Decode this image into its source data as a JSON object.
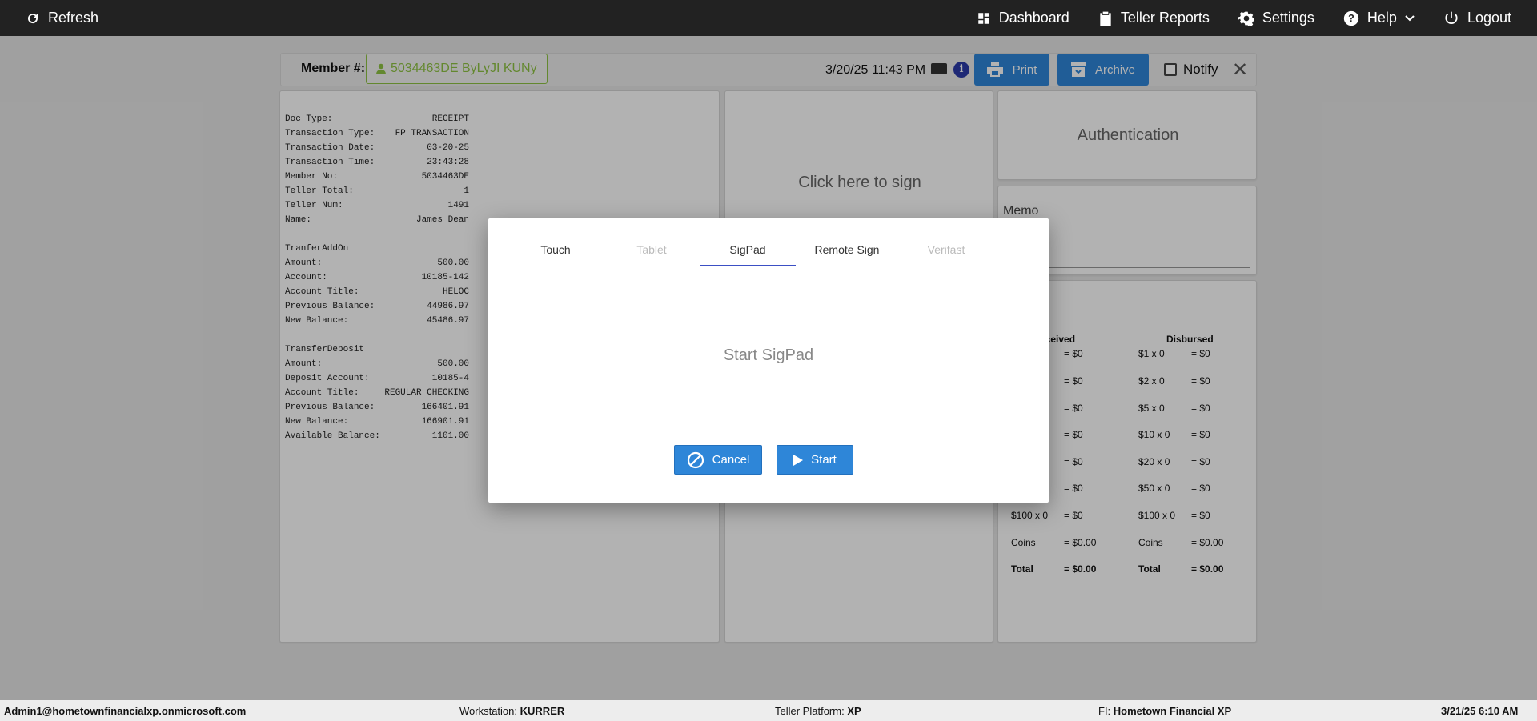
{
  "nav": {
    "refresh": "Refresh",
    "items": [
      {
        "label": "Dashboard",
        "icon": "dashboard-icon"
      },
      {
        "label": "Teller Reports",
        "icon": "clipboard-icon"
      },
      {
        "label": "Settings",
        "icon": "gear-icon"
      },
      {
        "label": "Help",
        "icon": "help-icon"
      },
      {
        "label": "Logout",
        "icon": "power-icon"
      }
    ]
  },
  "member": {
    "label": "Member #:",
    "value": "5034463DE ByLyJI KUNy",
    "datetime": "3/20/25 11:43 PM",
    "print": "Print",
    "archive": "Archive",
    "notify": "Notify"
  },
  "receipt": [
    [
      "Doc Type:",
      "RECEIPT"
    ],
    [
      "Transaction Type:",
      "FP TRANSACTION"
    ],
    [
      "Transaction Date:",
      "03-20-25"
    ],
    [
      "Transaction Time:",
      "23:43:28"
    ],
    [
      "Member No:",
      "5034463DE"
    ],
    [
      "Teller Total:",
      "1"
    ],
    [
      "Teller Num:",
      "1491"
    ],
    [
      "Name:",
      "James Dean"
    ],
    [
      "",
      ""
    ],
    [
      "TranferAddOn",
      ""
    ],
    [
      "Amount:",
      "500.00"
    ],
    [
      "Account:",
      "10185-142"
    ],
    [
      "Account Title:",
      "HELOC"
    ],
    [
      "Previous Balance:",
      "44986.97"
    ],
    [
      "New Balance:",
      "45486.97"
    ],
    [
      "",
      ""
    ],
    [
      "TransferDeposit",
      ""
    ],
    [
      "Amount:",
      "500.00"
    ],
    [
      "Deposit Account:",
      "10185-4"
    ],
    [
      "Account Title:",
      "REGULAR CHECKING"
    ],
    [
      "Previous Balance:",
      "166401.91"
    ],
    [
      "New Balance:",
      "166901.91"
    ],
    [
      "Available Balance:",
      "1101.00"
    ]
  ],
  "sign": {
    "click": "Click here to sign"
  },
  "auth": {
    "title": "Authentication"
  },
  "memo": {
    "label": "Memo"
  },
  "cash": {
    "received_head": "eceived",
    "disbursed_head": "Disbursed",
    "received": [
      [
        "",
        "= $0"
      ],
      [
        "",
        "= $0"
      ],
      [
        "",
        "= $0"
      ],
      [
        "",
        "= $0"
      ],
      [
        "",
        "= $0"
      ],
      [
        "",
        "= $0"
      ],
      [
        "$100 x 0",
        "= $0"
      ],
      [
        "Coins",
        "= $0.00"
      ],
      [
        "Total",
        "= $0.00"
      ]
    ],
    "disbursed": [
      [
        "$1 x 0",
        "= $0"
      ],
      [
        "$2 x 0",
        "= $0"
      ],
      [
        "$5 x 0",
        "= $0"
      ],
      [
        "$10 x 0",
        "= $0"
      ],
      [
        "$20 x 0",
        "= $0"
      ],
      [
        "$50 x 0",
        "= $0"
      ],
      [
        "$100 x 0",
        "= $0"
      ],
      [
        "Coins",
        "= $0.00"
      ],
      [
        "Total",
        "= $0.00"
      ]
    ]
  },
  "modal": {
    "tabs": [
      {
        "label": "Touch",
        "state": "normal"
      },
      {
        "label": "Tablet",
        "state": "disabled"
      },
      {
        "label": "SigPad",
        "state": "active"
      },
      {
        "label": "Remote Sign",
        "state": "normal"
      },
      {
        "label": "Verifast",
        "state": "disabled"
      }
    ],
    "body": "Start SigPad",
    "cancel": "Cancel",
    "start": "Start"
  },
  "status": {
    "user": "Admin1@hometownfinancialxp.onmicrosoft.com",
    "workstation_label": "Workstation:",
    "workstation": "KURRER",
    "platform_label": "Teller Platform:",
    "platform": "XP",
    "fi_label": "FI:",
    "fi": "Hometown Financial XP",
    "datetime": "3/21/25 6:10 AM"
  },
  "colors": {
    "accent": "#2e86d8",
    "member_green": "#8fc344",
    "tab_active": "#3b4fc4",
    "topbar": "#222222"
  }
}
